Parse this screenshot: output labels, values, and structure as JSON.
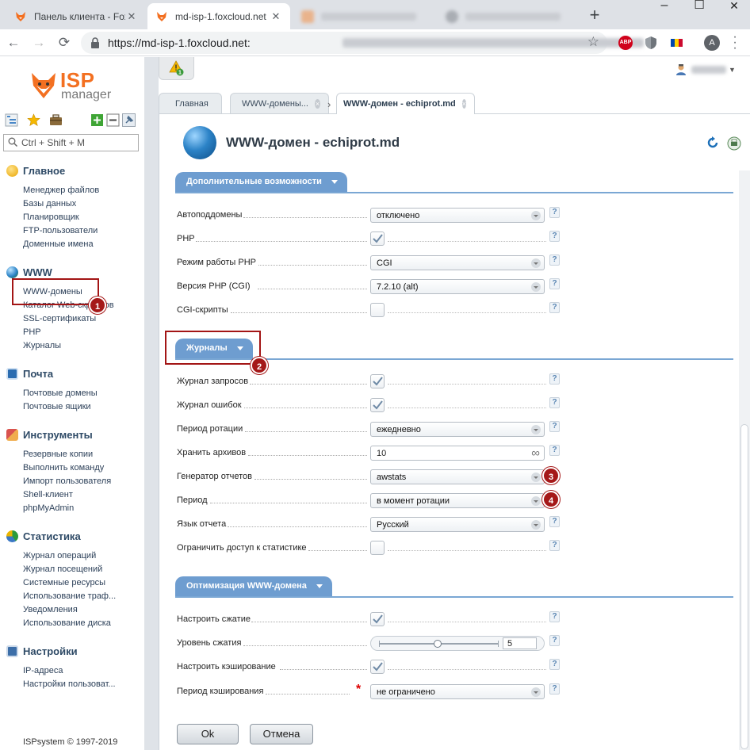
{
  "browser": {
    "tabs": [
      {
        "title": "Панель клиента - Fox",
        "active": false
      },
      {
        "title": "md-isp-1.foxcloud.net",
        "active": true
      }
    ],
    "window_controls": {
      "minimize": "–",
      "maximize": "☐",
      "close": "✕"
    },
    "new_tab": "+",
    "url": "https://md-isp-1.foxcloud.net:",
    "profile_letter": "A",
    "abp_label": "ABP"
  },
  "app": {
    "logo": {
      "brand": "ISP",
      "product": "manager"
    },
    "search_placeholder": "Ctrl + Shift + M",
    "alerts_count": "1",
    "nav": {
      "main": {
        "title": "Главное",
        "items": [
          "Менеджер файлов",
          "Базы данных",
          "Планировщик",
          "FTP-пользователи",
          "Доменные имена"
        ]
      },
      "www": {
        "title": "WWW",
        "items": [
          "WWW-домены",
          "Каталог Web-скриптов",
          "SSL-сертификаты",
          "PHP",
          "Журналы"
        ]
      },
      "mail": {
        "title": "Почта",
        "items": [
          "Почтовые домены",
          "Почтовые ящики"
        ]
      },
      "tools": {
        "title": "Инструменты",
        "items": [
          "Резервные копии",
          "Выполнить команду",
          "Импорт пользователя",
          "Shell-клиент",
          "phpMyAdmin"
        ]
      },
      "stats": {
        "title": "Статистика",
        "items": [
          "Журнал операций",
          "Журнал посещений",
          "Системные ресурсы",
          "Использование траф...",
          "Уведомления",
          "Использование диска"
        ]
      },
      "settings": {
        "title": "Настройки",
        "items": [
          "IP-адреса",
          "Настройки пользоват..."
        ]
      }
    },
    "copyright": "ISPsystem © 1997-2019",
    "tabs": [
      {
        "label": "Главная",
        "closable": false
      },
      {
        "label": "WWW-домены...",
        "closable": true
      },
      {
        "label": "WWW-домен - echiprot.md",
        "closable": true
      }
    ],
    "tab_separator": "›",
    "close_glyph": "×",
    "page_title": "WWW-домен - echiprot.md",
    "sections": {
      "extra": {
        "title": "Дополнительные возможности",
        "rows": [
          {
            "label": "Автоподдомены",
            "type": "select",
            "value": "отключено"
          },
          {
            "label": "PHP",
            "type": "checkbox",
            "checked": true
          },
          {
            "label": "Режим работы PHP",
            "type": "select",
            "value": "CGI"
          },
          {
            "label": "Версия PHP (CGI)",
            "type": "select",
            "value": "7.2.10 (alt)"
          },
          {
            "label": "CGI-скрипты",
            "type": "checkbox",
            "checked": false
          }
        ]
      },
      "logs": {
        "title": "Журналы",
        "rows": [
          {
            "label": "Журнал запросов",
            "type": "checkbox",
            "checked": true
          },
          {
            "label": "Журнал ошибок",
            "type": "checkbox",
            "checked": true
          },
          {
            "label": "Период ротации",
            "type": "select",
            "value": "ежедневно"
          },
          {
            "label": "Хранить архивов",
            "type": "input",
            "value": "10",
            "suffix_icon": "infinity-icon"
          },
          {
            "label": "Генератор отчетов",
            "type": "select",
            "value": "awstats"
          },
          {
            "label": "Период",
            "type": "select",
            "value": "в момент ротации"
          },
          {
            "label": "Язык отчета",
            "type": "select",
            "value": "Русский"
          },
          {
            "label": "Ограничить доступ к статистике",
            "type": "checkbox",
            "checked": false
          }
        ]
      },
      "opt": {
        "title": "Оптимизация WWW-домена",
        "rows": [
          {
            "label": "Настроить сжатие",
            "type": "checkbox",
            "checked": true
          },
          {
            "label": "Уровень сжатия",
            "type": "slider",
            "value": "5",
            "min": 1,
            "max": 9
          },
          {
            "label": "Настроить кэширование",
            "type": "checkbox",
            "checked": true
          },
          {
            "label": "Период кэширования",
            "type": "select",
            "value": "не ограничено",
            "required": true
          }
        ]
      }
    },
    "help_glyph": "?",
    "required_mark": "*",
    "infinity_glyph": "∞",
    "buttons": {
      "ok": "Ok",
      "cancel": "Отмена"
    }
  },
  "annotations": [
    "1",
    "2",
    "3",
    "4"
  ],
  "colors": {
    "section_blue": "#6e9dd0",
    "brand_orange": "#f37021",
    "annotation_red": "#a51919",
    "nav_text": "#2b3f58"
  }
}
